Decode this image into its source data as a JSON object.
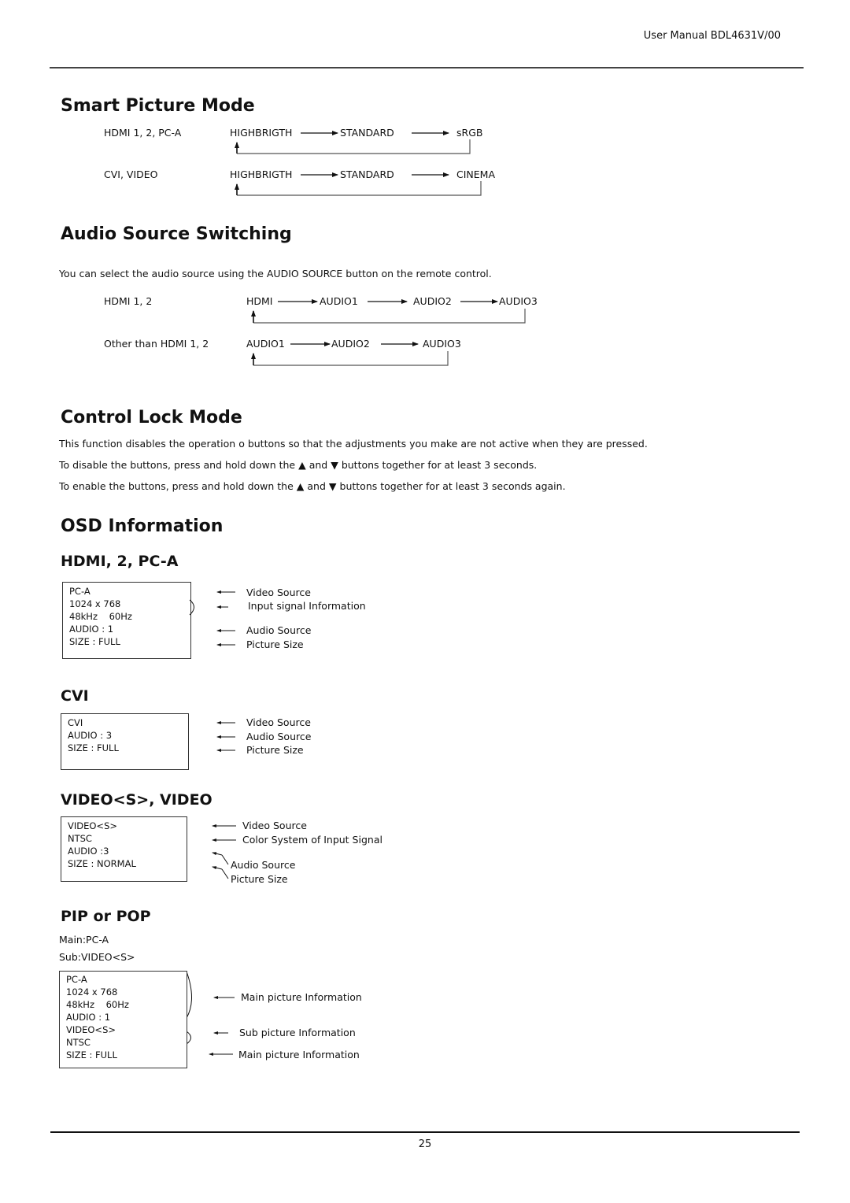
{
  "header": {
    "title": "User Manual BDL4631V/00"
  },
  "footer": {
    "page_number": "25"
  },
  "smart_picture": {
    "title": "Smart Picture Mode",
    "rows": [
      {
        "source": "HDMI 1, 2, PC-A",
        "modes": [
          "HIGHBRIGTH",
          "STANDARD",
          "sRGB"
        ]
      },
      {
        "source": "CVI, VIDEO",
        "modes": [
          "HIGHBRIGTH",
          "STANDARD",
          "CINEMA"
        ]
      }
    ]
  },
  "audio_source": {
    "title": "Audio Source Switching",
    "description": "You can select the audio source using the AUDIO SOURCE button on the remote control.",
    "rows": [
      {
        "source": "HDMI 1, 2",
        "modes": [
          "HDMI",
          "AUDIO1",
          "AUDIO2",
          "AUDIO3"
        ]
      },
      {
        "source": "Other than HDMI 1, 2",
        "modes": [
          "AUDIO1",
          "AUDIO2",
          "AUDIO3"
        ]
      }
    ]
  },
  "control_lock": {
    "title": "Control Lock Mode",
    "p1": "This function disables the operation o buttons so that the adjustments you make are not active when they are pressed.",
    "p2_a": "To disable the buttons, press and hold down the",
    "p2_b": "and",
    "p2_c": "buttons together for at least 3 seconds.",
    "p3_a": "To enable the buttons, press and hold down the",
    "p3_b": "and",
    "p3_c": "buttons together for at least 3 seconds again.",
    "up_symbol": "▲",
    "down_symbol": "▼"
  },
  "osd": {
    "title": "OSD Information",
    "hdmi": {
      "title": "HDMI, 2, PC-A",
      "lines": [
        "PC-A",
        "1024 x 768",
        "48kHz    60Hz",
        "AUDIO : 1",
        "SIZE : FULL"
      ],
      "labels": [
        "Video Source",
        "Input signal Information",
        "Audio Source",
        "Picture Size"
      ]
    },
    "cvi": {
      "title": "CVI",
      "lines": [
        "CVI",
        "AUDIO : 3",
        "SIZE : FULL"
      ],
      "labels": [
        "Video Source",
        "Audio Source",
        "Picture Size"
      ]
    },
    "video": {
      "title": "VIDEO<S>, VIDEO",
      "lines": [
        "VIDEO<S>",
        "NTSC",
        "AUDIO :3",
        "SIZE : NORMAL"
      ],
      "labels": [
        "Video Source",
        "Color System of Input Signal",
        "Audio Source",
        "Picture Size"
      ]
    },
    "pip": {
      "title_a": "PIP",
      "title_b": "or",
      "title_c": "POP",
      "main": "Main:PC-A",
      "sub": "Sub:VIDEO<S>",
      "lines": [
        "PC-A",
        "1024 x 768",
        "48kHz    60Hz",
        "AUDIO : 1",
        "VIDEO<S>",
        "NTSC",
        "SIZE : FULL"
      ],
      "labels": [
        "Main picture Information",
        "Sub picture Information",
        "Main picture Information"
      ]
    }
  }
}
